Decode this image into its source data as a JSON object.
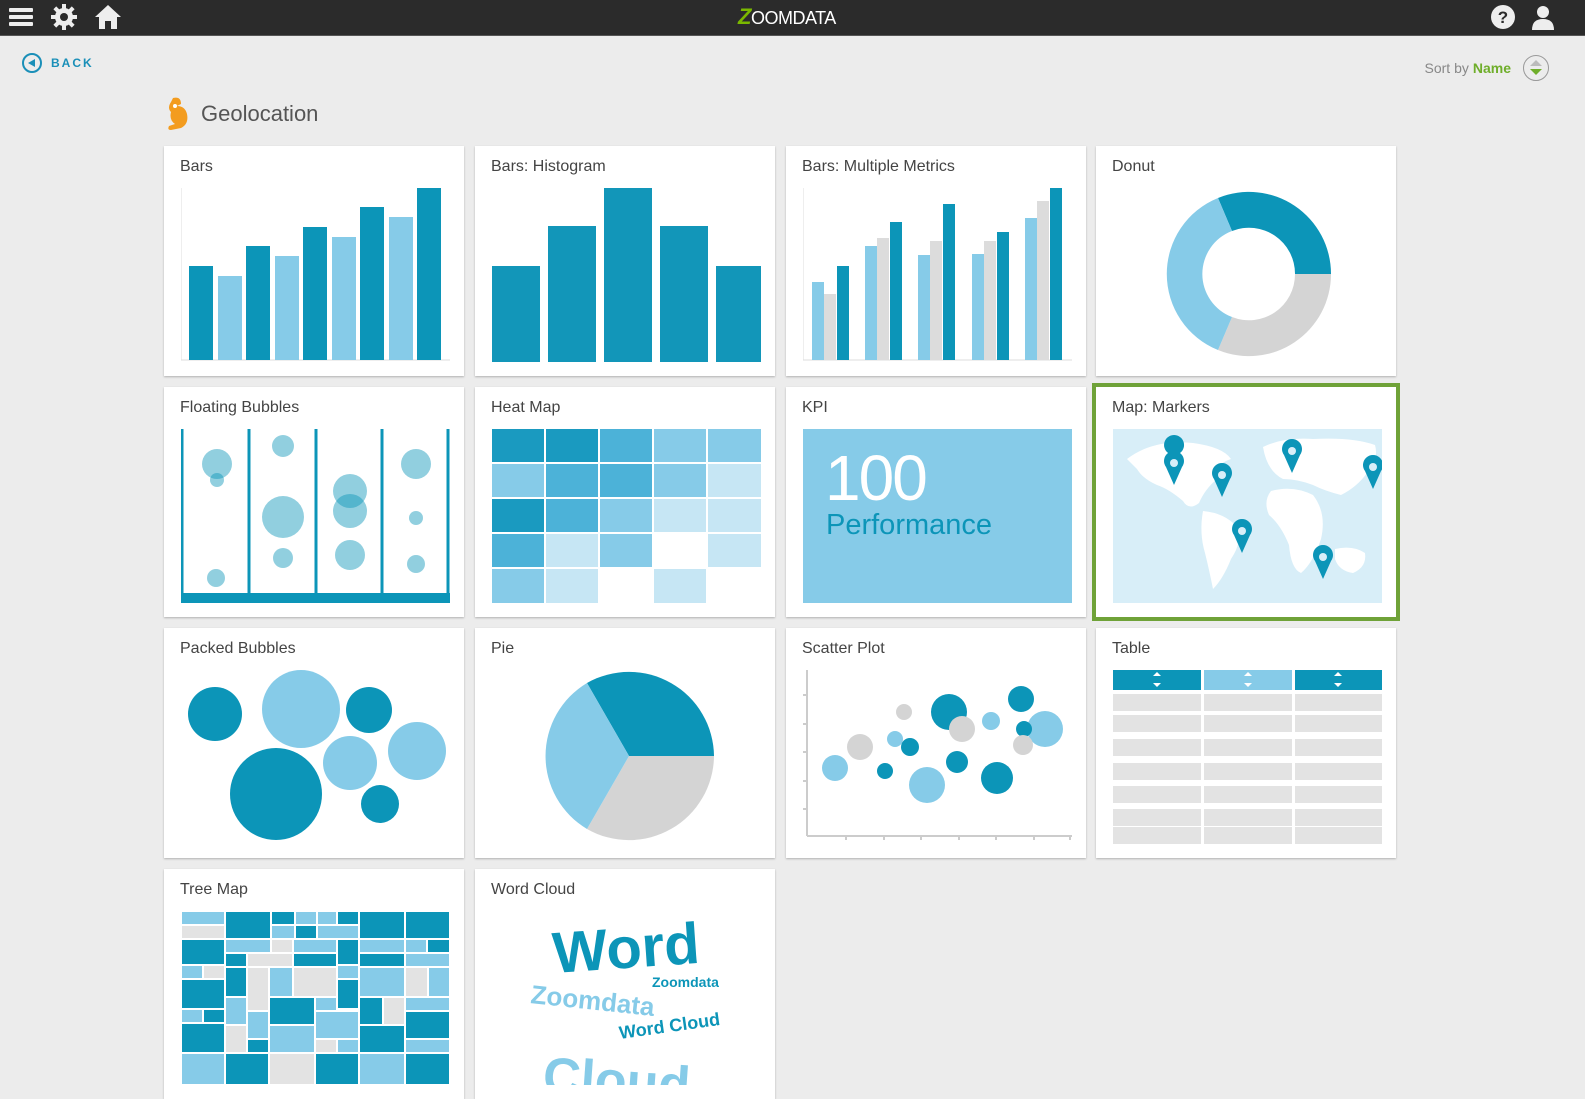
{
  "topbar": {
    "logo_text": "OOMDATA",
    "logo_mark": "Z",
    "icons": [
      "menu-icon",
      "gear-icon",
      "home-icon",
      "help-icon",
      "user-icon"
    ]
  },
  "back": {
    "label": "BACK"
  },
  "sort": {
    "prefix": "Sort by",
    "value": "Name"
  },
  "section": {
    "title": "Geolocation"
  },
  "cards": [
    {
      "title": "Bars"
    },
    {
      "title": "Bars: Histogram"
    },
    {
      "title": "Bars: Multiple Metrics"
    },
    {
      "title": "Donut"
    },
    {
      "title": "Floating Bubbles"
    },
    {
      "title": "Heat Map"
    },
    {
      "title": "KPI"
    },
    {
      "title": "Map: Markers",
      "selected": true
    },
    {
      "title": "Packed Bubbles"
    },
    {
      "title": "Pie"
    },
    {
      "title": "Scatter Plot"
    },
    {
      "title": "Table"
    },
    {
      "title": "Tree Map"
    },
    {
      "title": "Word Cloud"
    }
  ],
  "kpi": {
    "value": "100",
    "label": "Performance"
  },
  "wordcloud": {
    "words": [
      "Word",
      "Zoomdata",
      "Zoomdata",
      "Word Cloud",
      "Cloud"
    ]
  },
  "colors": {
    "dark": "#0c95b8",
    "light": "#86cbe8",
    "grey": "#d4d4d4",
    "accent": "#6fae2a",
    "selected": "#6fa238"
  }
}
